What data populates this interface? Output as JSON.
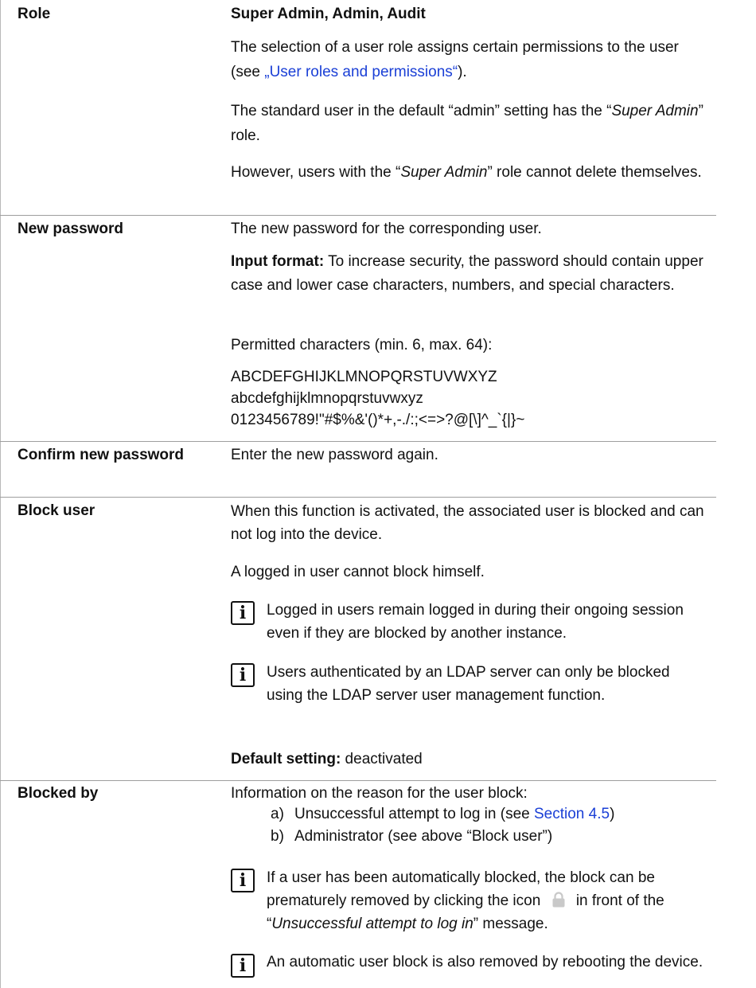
{
  "rows": {
    "role": {
      "term": "Role",
      "value": "Super Admin, Admin, Audit",
      "p1_pre": "The selection of a user role assigns certain permissions to the user (see ",
      "p1_link": "„User roles and permissions“",
      "p1_post": ").",
      "p2_a": "The standard user in the default “admin” setting has the “",
      "p2_b": "Super Admin",
      "p2_c": "” role.",
      "p3_a": "However, users with the “",
      "p3_b": "Super Admin",
      "p3_c": "” role cannot delete themselves."
    },
    "new_password": {
      "term": "New password",
      "p1": "The new password for the corresponding user.",
      "p2_label": "Input format:",
      "p2_text": " To increase security, the password should contain upper case and lower case characters, numbers, and special characters.",
      "p3": "Permitted characters (min. 6, max. 64):",
      "chars_upper": "ABCDEFGHIJKLMNOPQRSTUVWXYZ",
      "chars_lower": "abcdefghijklmnopqrstuvwxyz",
      "chars_other": "0123456789!\"#$%&'()*+,-./:;<=>?@[\\]^_`{|}~"
    },
    "confirm_password": {
      "term": "Confirm new password",
      "p1": "Enter the new password again."
    },
    "block_user": {
      "term": "Block user",
      "p1": "When this function is activated, the associated user is blocked and can not  log into the device.",
      "p2": "A logged in user cannot block himself.",
      "note1": "Logged in users remain logged in during their ongoing session even if they are blocked by another instance.",
      "note2": "Users authenticated by an LDAP server can only be blocked using the LDAP server user management function.",
      "default_label": "Default setting:",
      "default_value": " deactivated"
    },
    "blocked_by": {
      "term": "Blocked by",
      "p1": "Information on the reason for the user block:",
      "item_a_mark": "a)",
      "item_a_pre": "Unsuccessful attempt to log in (see ",
      "item_a_link": "Section 4.5",
      "item_a_post": ")",
      "item_b_mark": "b)",
      "item_b": "Administrator (see above “Block user”)",
      "note1_a": "If a user has been automatically blocked, the block can be prematurely removed by clicking the icon",
      "note1_b": "in front of the “",
      "note1_c": "Unsuccessful attempt to log in",
      "note1_d": "” message.",
      "note2": "An automatic user block is also removed by rebooting the device."
    }
  },
  "icons": {
    "info": "info-icon",
    "lock": "lock-icon"
  },
  "info_glyph": "i"
}
